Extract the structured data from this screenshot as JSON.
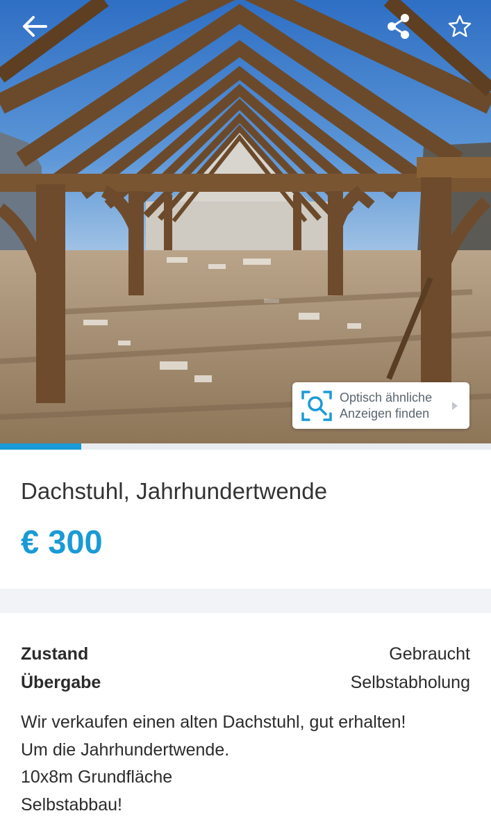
{
  "header": {
    "back_icon": "arrow-left-icon",
    "share_icon": "share-icon",
    "favorite_icon": "star-outline-icon"
  },
  "visual_search": {
    "icon": "visual-search-icon",
    "line1": "Optisch ähnliche",
    "line2": "Anzeigen finden",
    "chevron_icon": "chevron-right-icon"
  },
  "gallery": {
    "progress": 0.165,
    "accent_color": "#1a9ad6"
  },
  "listing": {
    "title": "Dachstuhl, Jahrhundertwende",
    "price": "€ 300"
  },
  "details": [
    {
      "label": "Zustand",
      "value": "Gebraucht"
    },
    {
      "label": "Übergabe",
      "value": "Selbstabholung"
    }
  ],
  "description": [
    "Wir verkaufen einen alten Dachstuhl, gut erhalten!",
    "Um die Jahrhundertwende.",
    "10x8m Grundfläche",
    "Selbstabbau!"
  ]
}
